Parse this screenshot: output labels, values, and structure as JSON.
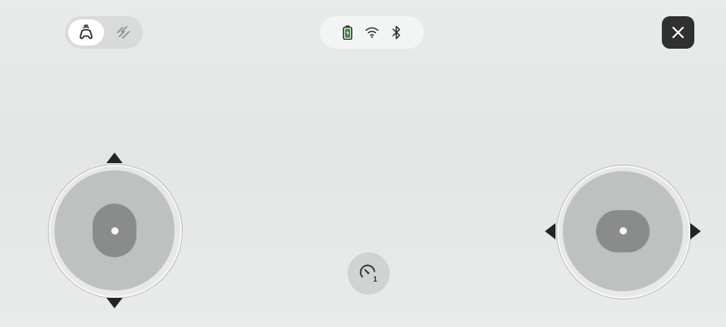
{
  "top_bar": {
    "mode_toggle": {
      "active_mode_icon": "gamepad-icon",
      "inactive_mode_icon": "motion-path-icon"
    },
    "status": {
      "battery_icon": "battery-icon",
      "battery_color": "#3a8a3a",
      "wifi_icon": "wifi-icon",
      "bluetooth_icon": "bluetooth-icon"
    },
    "close_icon": "close-icon"
  },
  "controls": {
    "left_joystick": {
      "axis": "vertical",
      "arrows": [
        "up",
        "down"
      ]
    },
    "right_joystick": {
      "axis": "horizontal",
      "arrows": [
        "left",
        "right"
      ]
    },
    "speed": {
      "icon": "speedometer-icon",
      "level": "1"
    }
  },
  "colors": {
    "background": "#e7e8e8",
    "close_button": "#2f3030",
    "joystick_base": "#bfc1c1",
    "joystick_knob": "#8a8c8c"
  }
}
